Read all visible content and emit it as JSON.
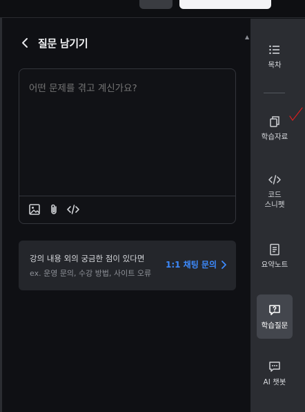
{
  "panel": {
    "title": "질문 남기기",
    "editor_placeholder": "어떤 문제를 겪고 계신가요?"
  },
  "inquiry": {
    "main_text": "강의 내용 외의 궁금한 점이 있다면",
    "sub_text": "ex. 운영 문의, 수강 방법, 사이트 오류",
    "link_label": "1:1 채팅 문의"
  },
  "sidebar": {
    "items": [
      {
        "label": "목차",
        "icon": "list-icon"
      },
      {
        "label": "학습자료",
        "icon": "copy-icon"
      },
      {
        "label": "코드\n스니펫",
        "icon": "code-icon"
      },
      {
        "label": "요약노트",
        "icon": "note-icon"
      },
      {
        "label": "학습질문",
        "icon": "question-bubble-icon",
        "active": true
      },
      {
        "label": "AI 챗봇",
        "icon": "chat-icon"
      }
    ]
  },
  "colors": {
    "accent": "#3d8bff",
    "panel_bg": "#0f1014",
    "sidebar_bg": "#2b2d32",
    "card_bg": "#24262b"
  }
}
